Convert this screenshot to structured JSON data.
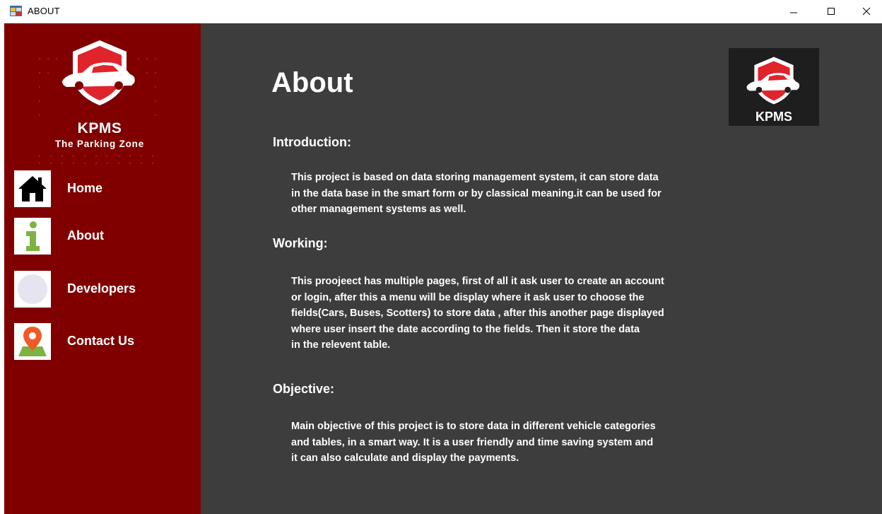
{
  "window": {
    "title": "ABOUT",
    "controls": [
      "minimize-icon",
      "maximize-icon",
      "close-icon"
    ]
  },
  "sidebar": {
    "brand": "KPMS",
    "tagline": "The Parking Zone",
    "items": [
      {
        "label": "Home",
        "icon": "home-icon"
      },
      {
        "label": "About",
        "icon": "info-icon"
      },
      {
        "label": "Developers",
        "icon": "developers-icon"
      },
      {
        "label": "Contact Us",
        "icon": "location-pin-icon"
      }
    ]
  },
  "main": {
    "title": "About",
    "logo_text": "KPMS",
    "sections": [
      {
        "heading": "Introduction:",
        "body": "This project is based on data storing management system, it can store data\nin the data base in the smart form or by classical meaning.it can be used for\nother management systems as well."
      },
      {
        "heading": "Working:",
        "body": "This proojeect has multiple pages, first of all it ask user to create an account\nor login, after this a menu will be display where it ask user to choose the\nfields(Cars, Buses, Scotters) to store data , after this another page displayed\nwhere user insert the date according to the fields. Then it store the data\nin the relevent table."
      },
      {
        "heading": "Objective:",
        "body": "Main objective of this project is to store data in different vehicle categories\nand tables, in a smart way. It is a user friendly and time saving system and\nit can also calculate and display the payments."
      }
    ]
  },
  "colors": {
    "sidebar": "#800000",
    "main_bg": "#3d3d3d",
    "text": "#ffffff",
    "logo_red": "#e0242b"
  }
}
